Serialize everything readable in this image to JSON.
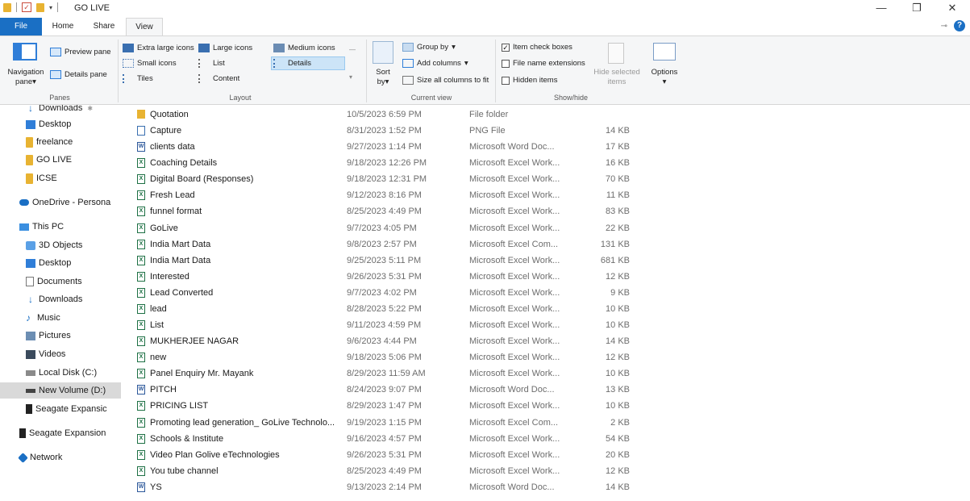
{
  "window": {
    "title": "GO LIVE",
    "minimize_glyph": "—",
    "restore_glyph": "❐",
    "close_glyph": "✕"
  },
  "tabs": {
    "file": "File",
    "home": "Home",
    "share": "Share",
    "view": "View"
  },
  "ribbon": {
    "panes": {
      "nav_pane_line1": "Navigation",
      "nav_pane_line2": "pane",
      "preview_pane": "Preview pane",
      "details_pane": "Details pane",
      "group_label": "Panes"
    },
    "layout": {
      "extra_large_icons": "Extra large icons",
      "large_icons": "Large icons",
      "medium_icons": "Medium icons",
      "small_icons": "Small icons",
      "list": "List",
      "details": "Details",
      "tiles": "Tiles",
      "content": "Content",
      "group_label": "Layout",
      "selected": "Details"
    },
    "current_view": {
      "sort_line1": "Sort",
      "sort_line2": "by",
      "group_by": "Group by",
      "add_columns": "Add columns",
      "size_all_columns": "Size all columns to fit",
      "group_label": "Current view"
    },
    "show_hide": {
      "item_check_boxes": "Item check boxes",
      "item_check_boxes_checked": true,
      "file_name_extensions": "File name extensions",
      "hidden_items": "Hidden items",
      "hide_selected_line1": "Hide selected",
      "hide_selected_line2": "items",
      "options": "Options",
      "group_label": "Show/hide"
    }
  },
  "nav": [
    {
      "label": "Downloads",
      "icon": "downloads-icon",
      "indent": 1
    },
    {
      "label": "Desktop",
      "icon": "desktop-icon",
      "indent": 1
    },
    {
      "label": "freelance",
      "icon": "folder-icon",
      "indent": 1
    },
    {
      "label": "GO LIVE",
      "icon": "folder-icon",
      "indent": 1
    },
    {
      "label": "ICSE",
      "icon": "folder-icon",
      "indent": 1
    },
    {
      "label": "OneDrive - Persona",
      "icon": "onedrive-icon",
      "indent": 0
    },
    {
      "label": "This PC",
      "icon": "this-pc-icon",
      "indent": 0
    },
    {
      "label": "3D Objects",
      "icon": "3d-objects-icon",
      "indent": 1
    },
    {
      "label": "Desktop",
      "icon": "desktop-icon",
      "indent": 1
    },
    {
      "label": "Documents",
      "icon": "documents-icon",
      "indent": 1
    },
    {
      "label": "Downloads",
      "icon": "downloads-icon",
      "indent": 1
    },
    {
      "label": "Music",
      "icon": "music-icon",
      "indent": 1
    },
    {
      "label": "Pictures",
      "icon": "pictures-icon",
      "indent": 1
    },
    {
      "label": "Videos",
      "icon": "videos-icon",
      "indent": 1
    },
    {
      "label": "Local Disk (C:)",
      "icon": "local-disk-icon",
      "indent": 1
    },
    {
      "label": "New Volume (D:)",
      "icon": "volume-icon",
      "indent": 1,
      "selected": true
    },
    {
      "label": "Seagate Expansic",
      "icon": "drive-icon",
      "indent": 1
    },
    {
      "label": "Seagate Expansion",
      "icon": "drive-icon",
      "indent": 0
    },
    {
      "label": "Network",
      "icon": "network-icon",
      "indent": 0
    }
  ],
  "files": [
    {
      "name": "Quotation",
      "date": "10/5/2023 6:59 PM",
      "type": "File folder",
      "size": "",
      "kind": "folder"
    },
    {
      "name": "Capture",
      "date": "8/31/2023 1:52 PM",
      "type": "PNG File",
      "size": "14 KB",
      "kind": "png"
    },
    {
      "name": "clients data",
      "date": "9/27/2023 1:14 PM",
      "type": "Microsoft Word Doc...",
      "size": "17 KB",
      "kind": "word"
    },
    {
      "name": "Coaching Details",
      "date": "9/18/2023 12:26 PM",
      "type": "Microsoft Excel Work...",
      "size": "16 KB",
      "kind": "excel"
    },
    {
      "name": "Digital Board (Responses)",
      "date": "9/18/2023 12:31 PM",
      "type": "Microsoft Excel Work...",
      "size": "70 KB",
      "kind": "excel"
    },
    {
      "name": "Fresh Lead",
      "date": "9/12/2023 8:16 PM",
      "type": "Microsoft Excel Work...",
      "size": "11 KB",
      "kind": "excel"
    },
    {
      "name": "funnel format",
      "date": "8/25/2023 4:49 PM",
      "type": "Microsoft Excel Work...",
      "size": "83 KB",
      "kind": "excel"
    },
    {
      "name": "GoLive",
      "date": "9/7/2023 4:05 PM",
      "type": "Microsoft Excel Work...",
      "size": "22 KB",
      "kind": "excel"
    },
    {
      "name": "India Mart Data",
      "date": "9/8/2023 2:57 PM",
      "type": "Microsoft Excel Com...",
      "size": "131 KB",
      "kind": "excel"
    },
    {
      "name": "India Mart Data",
      "date": "9/25/2023 5:11 PM",
      "type": "Microsoft Excel Work...",
      "size": "681 KB",
      "kind": "excel"
    },
    {
      "name": "Interested",
      "date": "9/26/2023 5:31 PM",
      "type": "Microsoft Excel Work...",
      "size": "12 KB",
      "kind": "excel"
    },
    {
      "name": "Lead Converted",
      "date": "9/7/2023 4:02 PM",
      "type": "Microsoft Excel Work...",
      "size": "9 KB",
      "kind": "excel"
    },
    {
      "name": "lead",
      "date": "8/28/2023 5:22 PM",
      "type": "Microsoft Excel Work...",
      "size": "10 KB",
      "kind": "excel"
    },
    {
      "name": "List",
      "date": "9/11/2023 4:59 PM",
      "type": "Microsoft Excel Work...",
      "size": "10 KB",
      "kind": "excel"
    },
    {
      "name": "MUKHERJEE NAGAR",
      "date": "9/6/2023 4:44 PM",
      "type": "Microsoft Excel Work...",
      "size": "14 KB",
      "kind": "excel"
    },
    {
      "name": "new",
      "date": "9/18/2023 5:06 PM",
      "type": "Microsoft Excel Work...",
      "size": "12 KB",
      "kind": "excel"
    },
    {
      "name": "Panel Enquiry Mr. Mayank",
      "date": "8/29/2023 11:59 AM",
      "type": "Microsoft Excel Work...",
      "size": "10 KB",
      "kind": "excel"
    },
    {
      "name": "PITCH",
      "date": "8/24/2023 9:07 PM",
      "type": "Microsoft Word Doc...",
      "size": "13 KB",
      "kind": "word"
    },
    {
      "name": "PRICING LIST",
      "date": "8/29/2023 1:47 PM",
      "type": "Microsoft Excel Work...",
      "size": "10 KB",
      "kind": "excel"
    },
    {
      "name": "Promoting lead generation_ GoLive Technolo...",
      "date": "9/19/2023 1:15 PM",
      "type": "Microsoft Excel Com...",
      "size": "2 KB",
      "kind": "excel"
    },
    {
      "name": "Schools & Institute",
      "date": "9/16/2023 4:57 PM",
      "type": "Microsoft Excel Work...",
      "size": "54 KB",
      "kind": "excel"
    },
    {
      "name": "Video Plan Golive eTechnologies",
      "date": "9/26/2023 5:31 PM",
      "type": "Microsoft Excel Work...",
      "size": "20 KB",
      "kind": "excel"
    },
    {
      "name": "You tube channel",
      "date": "8/25/2023 4:49 PM",
      "type": "Microsoft Excel Work...",
      "size": "12 KB",
      "kind": "excel"
    },
    {
      "name": "YS",
      "date": "9/13/2023 2:14 PM",
      "type": "Microsoft Word Doc...",
      "size": "14 KB",
      "kind": "word"
    }
  ],
  "colors": {
    "accent": "#1a6fc4",
    "selection": "#cce4f7",
    "nav_selected": "#d9d9d9"
  }
}
